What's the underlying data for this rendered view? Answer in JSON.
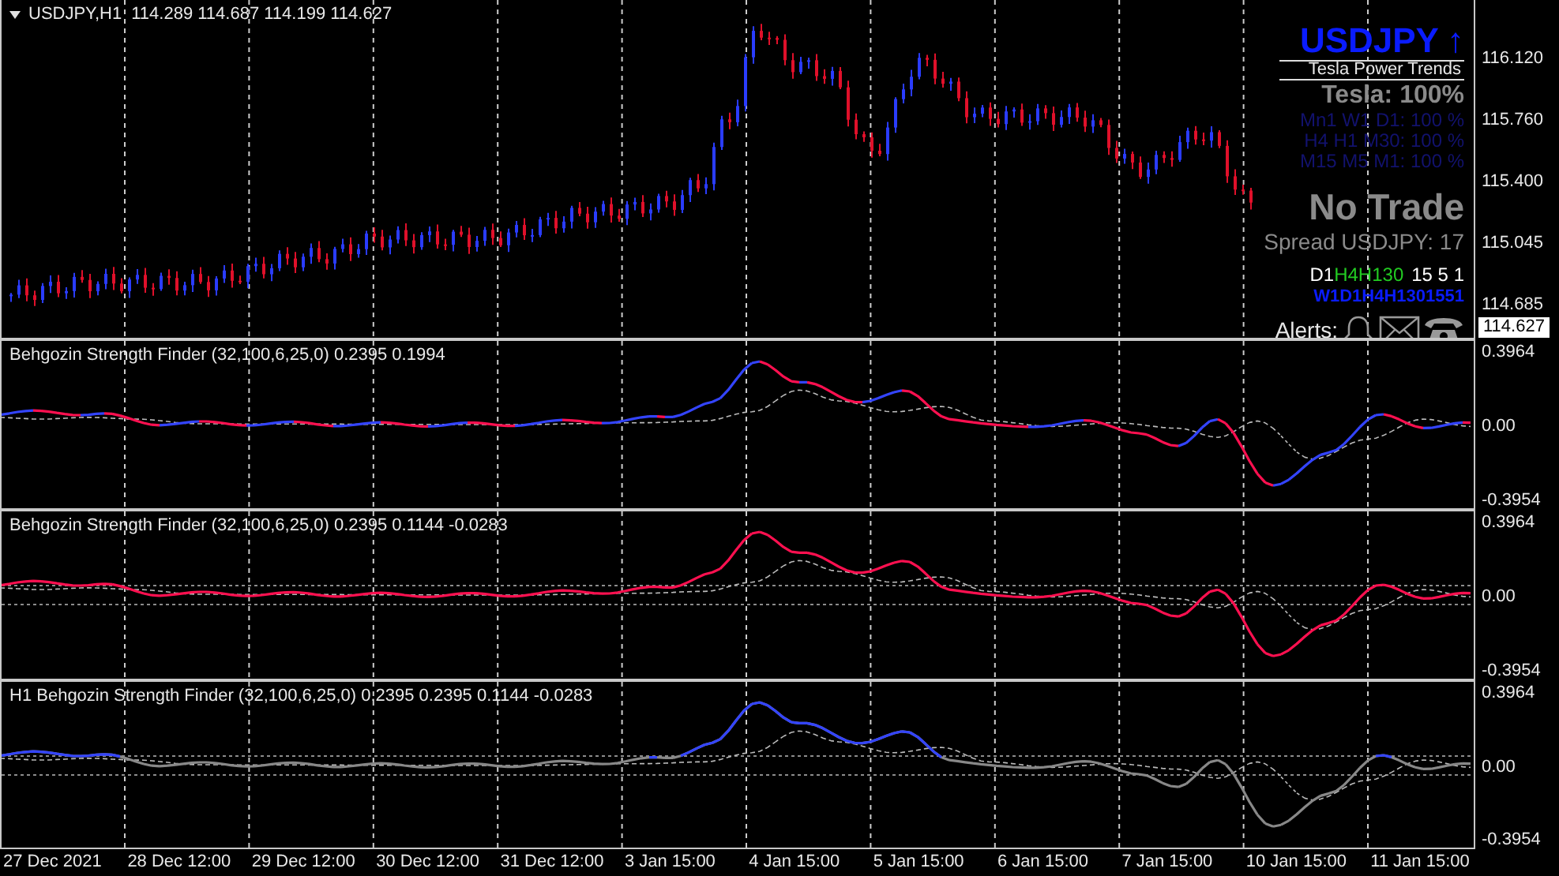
{
  "chart_header": {
    "symbol": "USDJPY,H1",
    "ohlc": "114.289 114.687 114.199 114.627"
  },
  "price_axis": {
    "ticks": [
      "116.120",
      "115.760",
      "115.400",
      "115.045",
      "114.685"
    ],
    "current_price": "114.627"
  },
  "overlay": {
    "symbol": "USDJPY",
    "trend_arrow": "↑",
    "subtitle": "Tesla Power Trends",
    "tesla": "Tesla: 100%",
    "timeframe_lines": [
      "Mn1 W1 D1: 100 %",
      "H4 H1 M30: 100 %",
      "M15 M5 M1: 100 %"
    ],
    "signal": "No Trade",
    "spread": "Spread USDJPY: 17",
    "timeframe_codes": [
      {
        "text": "D1",
        "color": "#ffffff"
      },
      {
        "text": "H4H130",
        "color": "#22cc22"
      },
      {
        "text": "15 5 1",
        "color": "#ffffff"
      }
    ],
    "timeframe_codes_2": "W1D1H4H1301551",
    "alerts_label": "Alerts:"
  },
  "indicators": [
    {
      "kind": "two-color",
      "label": "Behgozin Strength Finder (32,100,6,25,0) 0.2395 0.1994",
      "axis": [
        "0.3964",
        "0.00",
        "-0.3954"
      ]
    },
    {
      "kind": "single",
      "label": "Behgozin Strength Finder (32,100,6,25,0) 0.2395 0.1144 -0.0283",
      "axis": [
        "0.3964",
        "0.00",
        "-0.3954"
      ]
    },
    {
      "kind": "mtf",
      "label": "H1 Behgozin Strength Finder (32,100,6,25,0) 0.2395 0.2395 0.1144 -0.0283",
      "axis": [
        "0.3964",
        "0.00",
        "-0.3954"
      ]
    }
  ],
  "time_axis": [
    "27 Dec 2021",
    "28 Dec 12:00",
    "29 Dec 12:00",
    "30 Dec 12:00",
    "31 Dec 12:00",
    "3 Jan 15:00",
    "4 Jan 15:00",
    "5 Jan 15:00",
    "6 Jan 15:00",
    "7 Jan 15:00",
    "10 Jan 15:00",
    "11 Jan 15:00"
  ]
}
